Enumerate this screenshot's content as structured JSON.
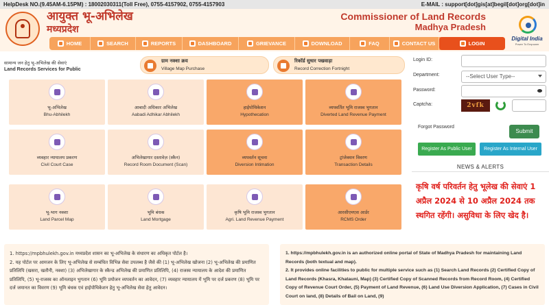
{
  "topbar": {
    "helpdesk": "HelpDesk NO.(9.45AM-6.15PM) : 18002030311(Toll Free), 0755-4157902, 0755-4157903",
    "email": "E-MAIL : support[dot]gis[at]begil[dot]org[dot]in"
  },
  "header": {
    "hindi_title": "आयुक्त भू-अभिलेख",
    "hindi_subtitle": "मध्यप्रदेश",
    "english_title": "Commissioner of Land Records",
    "english_subtitle": "Madhya Pradesh",
    "digital_india": "Digital India",
    "digital_tagline": "Power To Empower"
  },
  "nav": [
    "HOME",
    "SEARCH",
    "REPORTS",
    "DASHBOARD",
    "GRIEVANCE",
    "DOWNLOAD",
    "FAQ",
    "CONTACT US",
    "LOGIN"
  ],
  "services": {
    "heading_hindi": "सामान्य जन हेतु भू-अभिलेख की सेवाएं",
    "heading_english": "Land Records Services for Public",
    "pills": [
      {
        "hindi": "ग्राम नक्शा क्रय",
        "english": "Village Map Purchase"
      },
      {
        "hindi": "रिकॉर्ड सुधार पखवाड़ा",
        "english": "Record Correction Fortnight"
      }
    ],
    "tiles": [
      {
        "hindi": "भू-अभिलेख",
        "english": "Bhu-Abhilekh"
      },
      {
        "hindi": "आबादी अधिकार अभिलेख",
        "english": "Aabadi Adhikar Abhilekh"
      },
      {
        "hindi": "हाईपोथिकेशन",
        "english": "Hypothecation"
      },
      {
        "hindi": "व्यपवर्तित भूमि राजस्व भुगतान",
        "english": "Diverted Land Revenue Payment"
      },
      {
        "hindi": "व्यवहार न्यायालय प्रकरण",
        "english": "Civil Court Case"
      },
      {
        "hindi": "अभिलेखागार दस्तावेज़ (स्कैन)",
        "english": "Record Room Document (Scan)"
      },
      {
        "hindi": "व्यपवर्तन सूचना",
        "english": "Diversion Intimation"
      },
      {
        "hindi": "ट्रांजेक्शन विवरण",
        "english": "Transaction Details"
      },
      {
        "hindi": "भू-भाग नक्शा",
        "english": "Land Parcel Map"
      },
      {
        "hindi": "भूमि बंधक",
        "english": "Land Mortgage"
      },
      {
        "hindi": "कृषि भूमि राजस्व भुगतान",
        "english": "Agri. Land Revenue Payment"
      },
      {
        "hindi": "आरसीएमएस आर्डर",
        "english": "RCMS Order"
      }
    ]
  },
  "login": {
    "login_id_label": "Login ID:",
    "department_label": "Department:",
    "department_value": "--Select User Type--",
    "password_label": "Password:",
    "captcha_label": "Captcha:",
    "captcha_text": "2vfk",
    "forgot": "Forgot Password",
    "submit": "Submit",
    "register_public": "Register As Public User",
    "register_internal": "Register As Internal User"
  },
  "news": {
    "title": "NEWS & ALERTS",
    "text": "कृषि वर्ष परिवर्तन हेतु भूलेख की सेवाएं 1 अप्रैल 2024 से 10 अप्रैल 2024 तक स्थगित रहेंगी। असुविधा के लिए खेद है।"
  },
  "info_hindi": [
    "1. https://mpbhulekh.gov.in मध्यप्रदेश शासन का भू-अभिलेख के संधारण का अधिकृत पोर्टल है।",
    "2. यह पोर्टल पर आमजन के लिए भू-अभिलेख से सम्बंधित विभिन्न सेवा उपलब्ध है जैसे की (1) भू-अभिलेख खोजना (2) भू-अभिलेख की प्रमाणित प्रतिलिपि (खसरा, खतौनी, नक्शा) (3) अभिलेखागार के स्कैन्ड अभिलेख की प्रमाणित प्रतिलिपि, (4) राजस्व न्यायालय के आदेश की प्रमाणित प्रतिलिपि, (5) भू-राजस्व का ऑनलाइन भुगतान (6) भूमि प्रयोजन व्यपवर्तन का आवेदन, (7) व्यवहार न्यायालय में भूमि पर दर्ज प्रकरण (8) भूमि पर दर्ज जमानत का विवरण (9) भूमि बंधक एवं हाईपोथिकेशन हेतु भू-अभिलेख सेवा हेतु आवेदन।"
  ],
  "info_english": [
    "1. https://mpbhulekh.gov.in is an authorized online portal of State of Madhya Pradesh for maintaining Land Records (both textual and map).",
    "2. It provides online facilities to public for multiple service such as (1) Search Land Records (2) Certified Copy of Land Records (Khasra, Khatauni, Map) (3) Certified Copy of Scanned Records from Record Room, (4) Certified Copy of Revenue Court Order, (5) Payment of Land Revenue, (6) Land Use Diversion Application, (7) Cases in Civil Court on land, (8) Details of Bail on Land, (9)"
  ]
}
